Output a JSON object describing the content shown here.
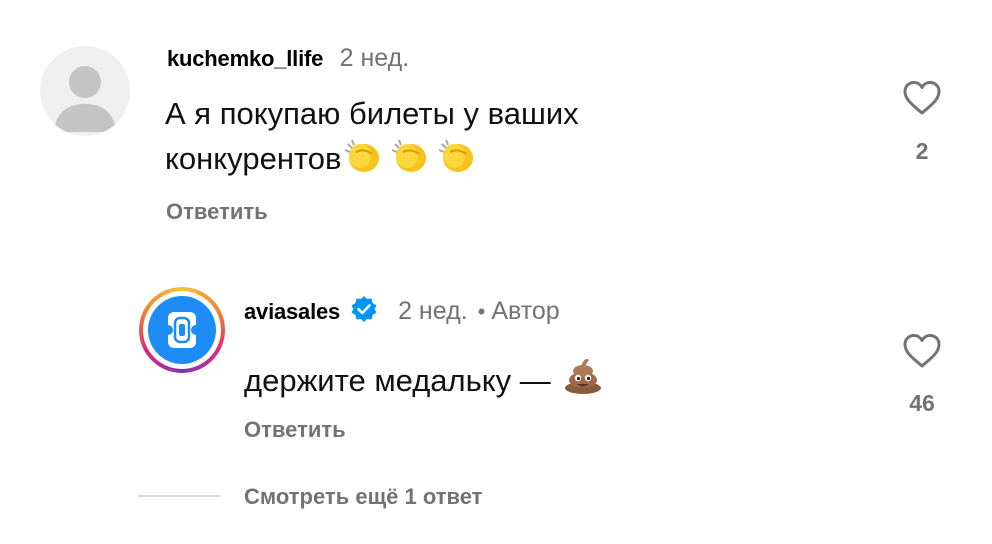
{
  "comments": [
    {
      "username": "kuchemko_llife",
      "time": "2 нед.",
      "text_line1": "А я покупаю билеты у ваших",
      "text_line2": "конкурентов",
      "emoji": "clapping-hands-emoji",
      "reply_label": "Ответить",
      "likes": "2",
      "avatar": "default-user-avatar"
    },
    {
      "username": "aviasales",
      "verified": true,
      "time": "2 нед.",
      "author_label": "Автор",
      "separator": "•",
      "text": "держите медальку —",
      "emoji": "pile-of-poo-emoji",
      "reply_label": "Ответить",
      "likes": "46",
      "avatar": "aviasales-logo"
    }
  ],
  "view_replies": "Смотреть ещё 1 ответ",
  "colors": {
    "secondary_text": "#737373",
    "verified_blue": "#0095f6",
    "brand_blue": "#1d8cf5"
  }
}
